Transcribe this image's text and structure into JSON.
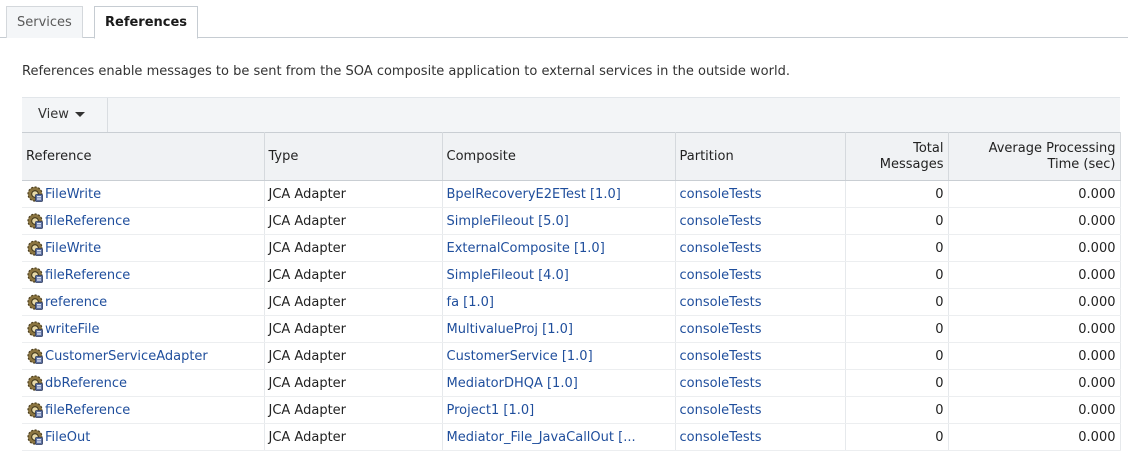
{
  "tabs": [
    {
      "label": "Services"
    },
    {
      "label": "References"
    }
  ],
  "description": "References enable messages to be sent from the SOA composite application to external services in the outside world.",
  "toolbar": {
    "view_label": "View"
  },
  "columns": {
    "reference": "Reference",
    "type": "Type",
    "composite": "Composite",
    "partition": "Partition",
    "total_line1": "Total",
    "total_line2": "Messages",
    "avg_line1": "Average Processing",
    "avg_line2": "Time (sec)"
  },
  "rows": [
    {
      "reference": "FileWrite",
      "type": "JCA Adapter",
      "composite": "BpelRecoveryE2ETest [1.0]",
      "partition": "consoleTests",
      "total": "0",
      "avg": "0.000"
    },
    {
      "reference": "fileReference",
      "type": "JCA Adapter",
      "composite": "SimpleFileout [5.0]",
      "partition": "consoleTests",
      "total": "0",
      "avg": "0.000"
    },
    {
      "reference": "FileWrite",
      "type": "JCA Adapter",
      "composite": "ExternalComposite [1.0]",
      "partition": "consoleTests",
      "total": "0",
      "avg": "0.000"
    },
    {
      "reference": "fileReference",
      "type": "JCA Adapter",
      "composite": "SimpleFileout [4.0]",
      "partition": "consoleTests",
      "total": "0",
      "avg": "0.000"
    },
    {
      "reference": "reference",
      "type": "JCA Adapter",
      "composite": "fa [1.0]",
      "partition": "consoleTests",
      "total": "0",
      "avg": "0.000"
    },
    {
      "reference": "writeFile",
      "type": "JCA Adapter",
      "composite": "MultivalueProj [1.0]",
      "partition": "consoleTests",
      "total": "0",
      "avg": "0.000"
    },
    {
      "reference": "CustomerServiceAdapter",
      "type": "JCA Adapter",
      "composite": "CustomerService [1.0]",
      "partition": "consoleTests",
      "total": "0",
      "avg": "0.000"
    },
    {
      "reference": "dbReference",
      "type": "JCA Adapter",
      "composite": "MediatorDHQA [1.0]",
      "partition": "consoleTests",
      "total": "0",
      "avg": "0.000"
    },
    {
      "reference": "fileReference",
      "type": "JCA Adapter",
      "composite": "Project1 [1.0]",
      "partition": "consoleTests",
      "total": "0",
      "avg": "0.000"
    },
    {
      "reference": "FileOut",
      "type": "JCA Adapter",
      "composite": "Mediator_File_JavaCallOut [...",
      "partition": "consoleTests",
      "total": "0",
      "avg": "0.000"
    }
  ],
  "icons": {
    "row_icon": "adapter-gear-icon",
    "view_caret": "caret-down-icon"
  },
  "colors": {
    "link": "#1f4e9c",
    "header_bg": "#f0f2f4",
    "toolbar_bg": "#f3f5f7"
  }
}
